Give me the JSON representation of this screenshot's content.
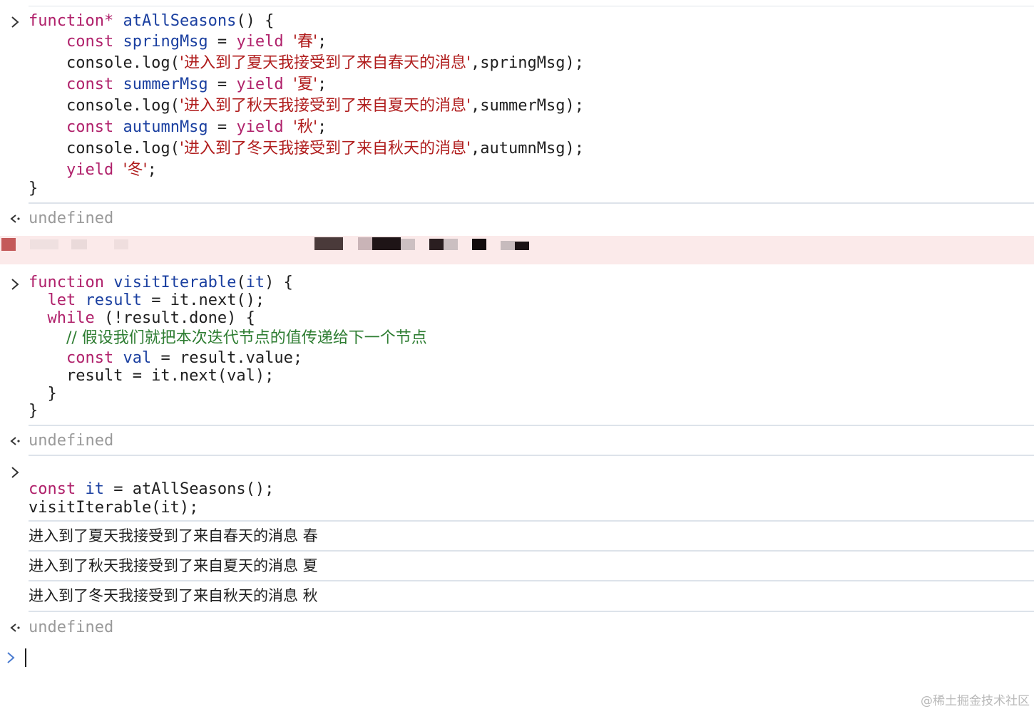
{
  "entries": {
    "first": {
      "lines": [
        {
          "parts": [
            [
              "kw",
              "function*"
            ],
            [
              "plain",
              " "
            ],
            [
              "fn",
              "atAllSeasons"
            ],
            [
              "plain",
              "() {"
            ]
          ]
        },
        {
          "parts": [
            [
              "plain",
              "    "
            ],
            [
              "kw",
              "const"
            ],
            [
              "plain",
              " "
            ],
            [
              "var",
              "springMsg"
            ],
            [
              "plain",
              " = "
            ],
            [
              "kw",
              "yield"
            ],
            [
              "plain",
              " "
            ],
            [
              "str",
              "'春'"
            ],
            [
              "plain",
              ";"
            ]
          ]
        },
        {
          "parts": [
            [
              "plain",
              "    console.log("
            ],
            [
              "str",
              "'进入到了夏天我接受到了来自春天的消息'"
            ],
            [
              "plain",
              ",springMsg);"
            ]
          ]
        },
        {
          "parts": [
            [
              "plain",
              "    "
            ],
            [
              "kw",
              "const"
            ],
            [
              "plain",
              " "
            ],
            [
              "var",
              "summerMsg"
            ],
            [
              "plain",
              " = "
            ],
            [
              "kw",
              "yield"
            ],
            [
              "plain",
              " "
            ],
            [
              "str",
              "'夏'"
            ],
            [
              "plain",
              ";"
            ]
          ]
        },
        {
          "parts": [
            [
              "plain",
              "    console.log("
            ],
            [
              "str",
              "'进入到了秋天我接受到了来自夏天的消息'"
            ],
            [
              "plain",
              ",summerMsg);"
            ]
          ]
        },
        {
          "parts": [
            [
              "plain",
              "    "
            ],
            [
              "kw",
              "const"
            ],
            [
              "plain",
              " "
            ],
            [
              "var",
              "autumnMsg"
            ],
            [
              "plain",
              " = "
            ],
            [
              "kw",
              "yield"
            ],
            [
              "plain",
              " "
            ],
            [
              "str",
              "'秋'"
            ],
            [
              "plain",
              ";"
            ]
          ]
        },
        {
          "parts": [
            [
              "plain",
              "    console.log("
            ],
            [
              "str",
              "'进入到了冬天我接受到了来自秋天的消息'"
            ],
            [
              "plain",
              ",autumnMsg);"
            ]
          ]
        },
        {
          "parts": [
            [
              "plain",
              "    "
            ],
            [
              "kw",
              "yield"
            ],
            [
              "plain",
              " "
            ],
            [
              "str",
              "'冬'"
            ],
            [
              "plain",
              ";"
            ]
          ]
        },
        {
          "parts": [
            [
              "plain",
              "}"
            ]
          ]
        }
      ],
      "result": "undefined"
    },
    "second": {
      "lines": [
        {
          "parts": [
            [
              "kw",
              "function"
            ],
            [
              "plain",
              " "
            ],
            [
              "fn",
              "visitIterable"
            ],
            [
              "plain",
              "("
            ],
            [
              "var",
              "it"
            ],
            [
              "plain",
              ") {"
            ]
          ]
        },
        {
          "parts": [
            [
              "plain",
              "  "
            ],
            [
              "kw",
              "let"
            ],
            [
              "plain",
              " "
            ],
            [
              "var",
              "result"
            ],
            [
              "plain",
              " = it.next();"
            ]
          ]
        },
        {
          "parts": [
            [
              "plain",
              "  "
            ],
            [
              "kw",
              "while"
            ],
            [
              "plain",
              " (!result.done) {"
            ]
          ]
        },
        {
          "parts": [
            [
              "plain",
              "    "
            ],
            [
              "comment",
              "// 假设我们就把本次迭代节点的值传递给下一个节点"
            ]
          ]
        },
        {
          "parts": [
            [
              "plain",
              "    "
            ],
            [
              "kw",
              "const"
            ],
            [
              "plain",
              " "
            ],
            [
              "var",
              "val"
            ],
            [
              "plain",
              " = result.value;"
            ]
          ]
        },
        {
          "parts": [
            [
              "plain",
              "    result = it.next(val);"
            ]
          ]
        },
        {
          "parts": [
            [
              "plain",
              "  }"
            ]
          ]
        },
        {
          "parts": [
            [
              "plain",
              "}"
            ]
          ]
        }
      ],
      "result": "undefined"
    },
    "third": {
      "lines": [
        {
          "parts": [
            [
              "kw",
              "const"
            ],
            [
              "plain",
              " "
            ],
            [
              "var",
              "it"
            ],
            [
              "plain",
              " = atAllSeasons();"
            ]
          ]
        },
        {
          "parts": [
            [
              "plain",
              "visitIterable(it);"
            ]
          ]
        }
      ],
      "logs": [
        "进入到了夏天我接受到了来自春天的消息 春",
        "进入到了秋天我接受到了来自夏天的消息 夏",
        "进入到了冬天我接受到了来自秋天的消息 秋"
      ],
      "result": "undefined"
    }
  },
  "colors": {
    "keyword": "#b0216b",
    "identifier": "#1a3fa0",
    "string": "#b01d1d",
    "comment": "#2e7d32",
    "result": "#9a9a9a",
    "error_bg": "#fbeaea"
  },
  "icons": {
    "input_prompt": "chevron-right-icon",
    "result_prompt": "return-arrow-icon",
    "active_prompt": "chevron-right-icon"
  },
  "watermark": "@稀土掘金技术社区"
}
